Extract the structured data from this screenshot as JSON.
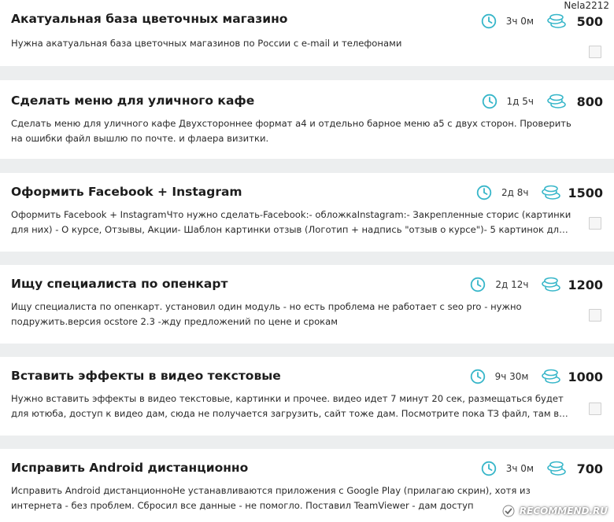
{
  "header": {
    "username": "Nela2212"
  },
  "colors": {
    "clock_accent": "#37b6c9",
    "coins_accent": "#37b6c9",
    "background": "#eceeef"
  },
  "tasks": [
    {
      "title": "Акатуальная база цветочных магазино",
      "time": "3ч 0м",
      "price": "500",
      "description": "Нужна акатуальная база цветочных магазинов по России с e-mail и телефонами"
    },
    {
      "title": "Сделать меню для уличного кафе",
      "time": "1д 5ч",
      "price": "800",
      "description": "Сделать меню для уличного кафе Двухстороннее формат а4 и отдельно барное меню а5 с двух сторон. Проверить на ошибки файл вышлю по почте. и флаера визитки."
    },
    {
      "title": "Оформить Facebook + Instagram",
      "time": "2д 8ч",
      "price": "1500",
      "description": "Оформить Facebook + InstagramЧто нужно сделать-Facebook:- обложкаInstagram:- Закрепленные сторис (картинки для них) - О курсе, Отзывы, Акции- Шаблон картинки отзыв (Логотип + надпись \"отзыв о курсе\")- 5 картинок для по..."
    },
    {
      "title": "Ищу специалиста по опенкарт",
      "time": "2д 12ч",
      "price": "1200",
      "description": "Ищу специалиста по опенкарт. установил один модуль - но есть проблема не работает с seo pro - нужно подружить.версия ocstore 2.3 -жду предложений по цене и срокам"
    },
    {
      "title": "Вставить эффекты в видео текстовые",
      "time": "9ч 30м",
      "price": "1000",
      "description": "Нужно вставить эффекты в видео текстовые, картинки и прочее. видео идет 7 минут 20 сек, размещаться будет для ютюба, доступ к видео дам, сюда не получается загрузить, сайт тоже дам. Посмотрите пока ТЗ файл, там все рассп..."
    },
    {
      "title": "Исправить Android дистанционно",
      "time": "3ч 0м",
      "price": "700",
      "description": "Исправить Android дистанционноНе устанавливаются приложения с Google Play (прилагаю скрин), хотя из интернета - без проблем. Сбросил все данные - не помогло. Поставил TeamViewer - дам доступ"
    }
  ],
  "watermark": {
    "text": "RECOMMEND.RU"
  }
}
